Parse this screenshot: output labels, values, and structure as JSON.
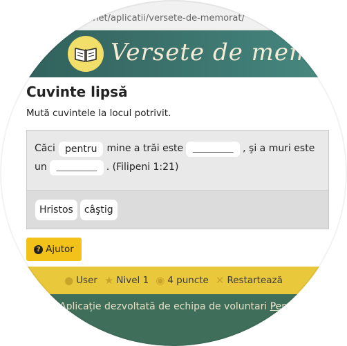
{
  "browser": {
    "url": "er.net/aplicatii/versete-de-memorat/"
  },
  "banner": {
    "title": "Versete de memorat",
    "logo_icon": "open-book-icon"
  },
  "page": {
    "heading": "Cuvinte lipsă",
    "instruction": "Mută cuvintele la locul potrivit."
  },
  "verse": {
    "seg1": "Căci",
    "placed_word": "pentru",
    "seg2": "mine a trăi este",
    "blank1": "_________",
    "seg3": ", şi a muri este",
    "seg4": "un",
    "blank2": "_________",
    "seg5": ". (Filipeni 1:21)"
  },
  "word_bank": [
    "Hristos",
    "câştig"
  ],
  "help_button": {
    "label": "Ajutor",
    "icon": "question-circle-icon"
  },
  "user_bar": {
    "user": "User",
    "level": "Nivel 1",
    "points": "4 puncte",
    "restart": "Restartează"
  },
  "credits": {
    "text": "Aplicație dezvoltată de echipa de voluntari",
    "link": "Pentru C"
  },
  "colors": {
    "banner": "#3a6e68",
    "accent_yellow": "#f2c21a",
    "footer_green": "#3f6f5b"
  }
}
